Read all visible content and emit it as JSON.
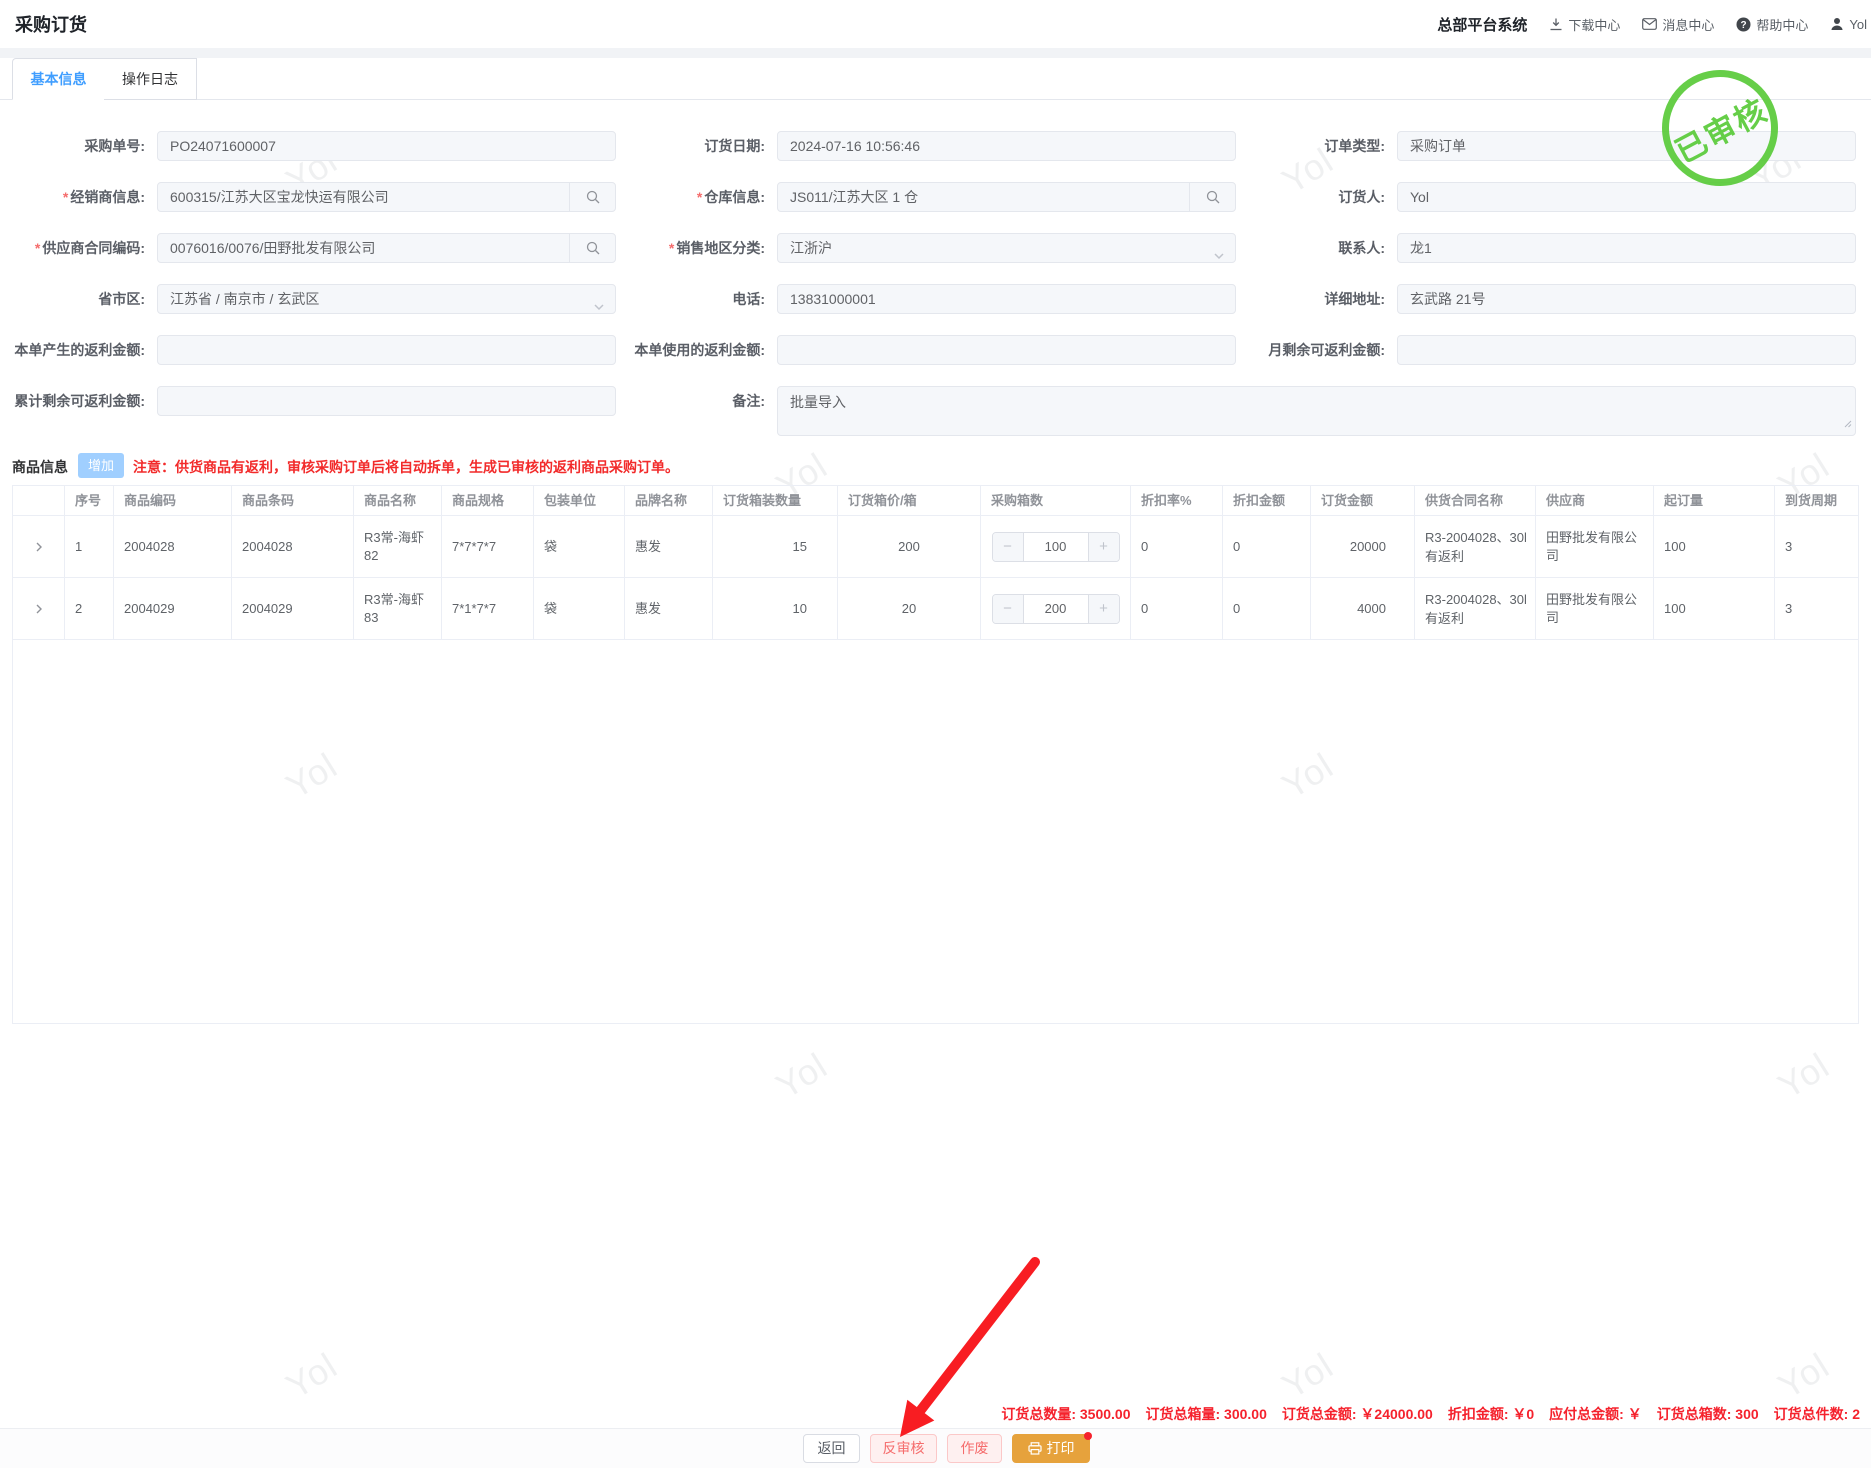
{
  "header": {
    "title": "采购订货",
    "system_name": "总部平台系统",
    "nav": [
      {
        "id": "download",
        "label": "下载中心"
      },
      {
        "id": "message",
        "label": "消息中心"
      },
      {
        "id": "help",
        "label": "帮助中心"
      },
      {
        "id": "user",
        "label": "Yol"
      }
    ]
  },
  "tabs": [
    {
      "label": "基本信息"
    },
    {
      "label": "操作日志"
    }
  ],
  "stamp_text": "已审核",
  "watermark_text": "Yol",
  "form_fields": [
    {
      "key": "po-number",
      "row": 0,
      "col": 0,
      "label": "采购单号:",
      "value": "PO24071600007",
      "required": false,
      "suffix": "",
      "kind": "input"
    },
    {
      "key": "order-date",
      "row": 0,
      "col": 1,
      "label": "订货日期:",
      "value": "2024-07-16 10:56:46",
      "required": false,
      "suffix": "",
      "kind": "input"
    },
    {
      "key": "order-type",
      "row": 0,
      "col": 2,
      "label": "订单类型:",
      "value": "采购订单",
      "required": false,
      "suffix": "",
      "kind": "input"
    },
    {
      "key": "dealer-info",
      "row": 1,
      "col": 0,
      "label": "经销商信息:",
      "value": "600315/江苏大区宝龙快运有限公司",
      "required": true,
      "suffix": "search",
      "kind": "input"
    },
    {
      "key": "warehouse-info",
      "row": 1,
      "col": 1,
      "label": "仓库信息:",
      "value": "JS011/江苏大区 1 仓",
      "required": true,
      "suffix": "search",
      "kind": "input"
    },
    {
      "key": "orderer",
      "row": 1,
      "col": 2,
      "label": "订货人:",
      "value": "Yol",
      "required": false,
      "suffix": "",
      "kind": "input"
    },
    {
      "key": "supplier-contract",
      "row": 2,
      "col": 0,
      "label": "供应商合同编码:",
      "value": "0076016/0076/田野批发有限公司",
      "required": true,
      "suffix": "search",
      "kind": "input"
    },
    {
      "key": "sales-region",
      "row": 2,
      "col": 1,
      "label": "销售地区分类:",
      "value": "江浙沪",
      "required": true,
      "suffix": "select",
      "kind": "input"
    },
    {
      "key": "contact",
      "row": 2,
      "col": 2,
      "label": "联系人:",
      "value": "龙1",
      "required": false,
      "suffix": "",
      "kind": "input"
    },
    {
      "key": "province-city",
      "row": 3,
      "col": 0,
      "label": "省市区:",
      "value": "江苏省 / 南京市 / 玄武区",
      "required": false,
      "suffix": "select",
      "kind": "input"
    },
    {
      "key": "phone",
      "row": 3,
      "col": 1,
      "label": "电话:",
      "value": "13831000001",
      "required": false,
      "suffix": "",
      "kind": "input"
    },
    {
      "key": "address",
      "row": 3,
      "col": 2,
      "label": "详细地址:",
      "value": "玄武路 21号",
      "required": false,
      "suffix": "",
      "kind": "input"
    },
    {
      "key": "rebate-generated",
      "row": 4,
      "col": 0,
      "label": "本单产生的返利金额:",
      "value": "",
      "required": false,
      "suffix": "",
      "kind": "input"
    },
    {
      "key": "rebate-used",
      "row": 4,
      "col": 1,
      "label": "本单使用的返利金额:",
      "value": "",
      "required": false,
      "suffix": "",
      "kind": "input"
    },
    {
      "key": "rebate-month-remain",
      "row": 4,
      "col": 2,
      "label": "月剩余可返利金额:",
      "value": "",
      "required": false,
      "suffix": "",
      "kind": "input"
    },
    {
      "key": "rebate-total-remain",
      "row": 5,
      "col": 0,
      "label": "累计剩余可返利金额:",
      "value": "",
      "required": false,
      "suffix": "",
      "kind": "input"
    },
    {
      "key": "remark",
      "row": 5,
      "col": 1,
      "label": "备注:",
      "value": "批量导入",
      "required": false,
      "suffix": "",
      "kind": "textarea",
      "wide": true
    }
  ],
  "section": {
    "title": "商品信息",
    "add_button": "增加",
    "notice": "注意：供货商品有返利，审核采购订单后将自动拆单，生成已审核的返利商品采购订单。"
  },
  "table": {
    "columns": [
      "",
      "序号",
      "商品编码",
      "商品条码",
      "商品名称",
      "商品规格",
      "包装单位",
      "品牌名称",
      "订货箱装数量",
      "订货箱价/箱",
      "采购箱数",
      "折扣率%",
      "折扣金额",
      "订货金额",
      "供货合同名称",
      "供应商",
      "起订量",
      "到货周期"
    ],
    "rows": [
      {
        "cells": [
          "1",
          "2004028",
          "2004028",
          "R3常-海虾82",
          "7*7*7*7",
          "袋",
          "惠发",
          "15",
          "200",
          "100",
          "0",
          "0",
          "20000",
          "R3-2004028、30l有返利",
          "田野批发有限公司",
          "100",
          "3"
        ]
      },
      {
        "cells": [
          "2",
          "2004029",
          "2004029",
          "R3常-海虾83",
          "7*1*7*7",
          "袋",
          "惠发",
          "10",
          "20",
          "200",
          "0",
          "0",
          "4000",
          "R3-2004028、30l有返利",
          "田野批发有限公司",
          "100",
          "3"
        ]
      }
    ]
  },
  "summary": [
    "订货总数量: 3500.00",
    "订货总箱量: 300.00",
    "订货总金额: ￥24000.00",
    "折扣金额: ￥0",
    "应付总金额: ￥",
    "订货总箱数: 300",
    "订货总件数: 2"
  ],
  "buttons": {
    "back": "返回",
    "unapprove": "反审核",
    "void_btn": "作废",
    "print": "打印"
  },
  "colors": {
    "accent": "#409eff",
    "danger_text": "#f56c6c",
    "notice_red": "#f22b2b",
    "summary_red": "#f5222d",
    "stamp_green": "#5bcb3b",
    "print_orange": "#e6a23c",
    "add_button_blue": "#a0cfff"
  }
}
